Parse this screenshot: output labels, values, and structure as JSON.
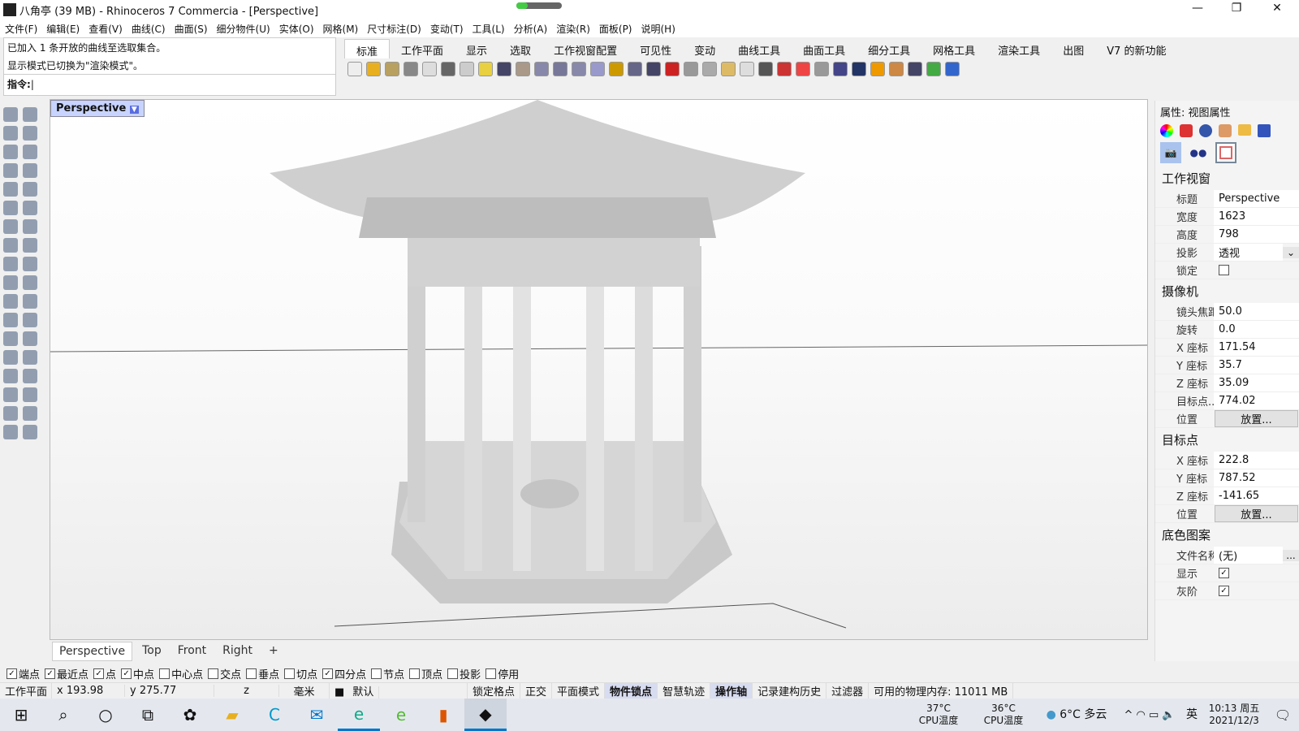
{
  "title": "八角亭 (39 MB) - Rhinoceros 7 Commercia - [Perspective]",
  "menu": [
    "文件(F)",
    "编辑(E)",
    "查看(V)",
    "曲线(C)",
    "曲面(S)",
    "细分物件(U)",
    "实体(O)",
    "网格(M)",
    "尺寸标注(D)",
    "变动(T)",
    "工具(L)",
    "分析(A)",
    "渲染(R)",
    "面板(P)",
    "说明(H)"
  ],
  "command": {
    "history": [
      "已加入 1 条开放的曲线至选取集合。",
      "显示模式已切换为\"渲染模式\"。"
    ],
    "prompt": "指令:"
  },
  "toolbar_tabs": [
    "标准",
    "工作平面",
    "显示",
    "选取",
    "工作视窗配置",
    "可见性",
    "变动",
    "曲线工具",
    "曲面工具",
    "细分工具",
    "网格工具",
    "渲染工具",
    "出图",
    "V7 的新功能"
  ],
  "viewport": {
    "label": "Perspective",
    "tabs": [
      "Perspective",
      "Top",
      "Front",
      "Right"
    ]
  },
  "panel": {
    "title": "属性: 视图属性",
    "sections": [
      {
        "heading": "工作视窗",
        "rows": [
          {
            "k": "标题",
            "v": "Perspective"
          },
          {
            "k": "宽度",
            "v": "1623"
          },
          {
            "k": "高度",
            "v": "798"
          },
          {
            "k": "投影",
            "v": "透视"
          },
          {
            "k": "锁定",
            "v": ""
          }
        ]
      },
      {
        "heading": "摄像机",
        "rows": [
          {
            "k": "镜头焦距",
            "v": "50.0"
          },
          {
            "k": "旋转",
            "v": "0.0"
          },
          {
            "k": "X 座标",
            "v": "171.54"
          },
          {
            "k": "Y 座标",
            "v": "35.7"
          },
          {
            "k": "Z 座标",
            "v": "35.09"
          },
          {
            "k": "目标点...",
            "v": "774.02"
          },
          {
            "k": "位置",
            "v": "放置..."
          }
        ]
      },
      {
        "heading": "目标点",
        "rows": [
          {
            "k": "X 座标",
            "v": "222.8"
          },
          {
            "k": "Y 座标",
            "v": "787.52"
          },
          {
            "k": "Z 座标",
            "v": "-141.65"
          },
          {
            "k": "位置",
            "v": "放置..."
          }
        ]
      },
      {
        "heading": "底色图案",
        "rows": [
          {
            "k": "文件名称",
            "v": "(无)"
          },
          {
            "k": "显示",
            "v": ""
          },
          {
            "k": "灰阶",
            "v": ""
          }
        ]
      }
    ]
  },
  "osnap": [
    {
      "l": "端点",
      "c": true
    },
    {
      "l": "最近点",
      "c": true
    },
    {
      "l": "点",
      "c": true
    },
    {
      "l": "中点",
      "c": true
    },
    {
      "l": "中心点",
      "c": false
    },
    {
      "l": "交点",
      "c": false
    },
    {
      "l": "垂点",
      "c": false
    },
    {
      "l": "切点",
      "c": false
    },
    {
      "l": "四分点",
      "c": true
    },
    {
      "l": "节点",
      "c": false
    },
    {
      "l": "顶点",
      "c": false
    },
    {
      "l": "投影",
      "c": false
    },
    {
      "l": "停用",
      "c": false
    }
  ],
  "status": {
    "cplane": "工作平面",
    "x": "x 193.98",
    "y": "y 275.77",
    "z": "z",
    "unit": "毫米",
    "layer": "默认",
    "toggles": [
      "锁定格点",
      "正交",
      "平面模式",
      "物件锁点",
      "智慧轨迹",
      "操作轴",
      "记录建构历史",
      "过滤器"
    ],
    "memory": "可用的物理内存: 11011 MB"
  },
  "taskbar": {
    "cpu1": "37°C",
    "cpu1_label": "CPU温度",
    "cpu2": "36°C",
    "cpu2_label": "CPU温度",
    "weather": "6°C 多云",
    "ime": "英",
    "time": "10:13 周五",
    "date": "2021/12/3"
  }
}
